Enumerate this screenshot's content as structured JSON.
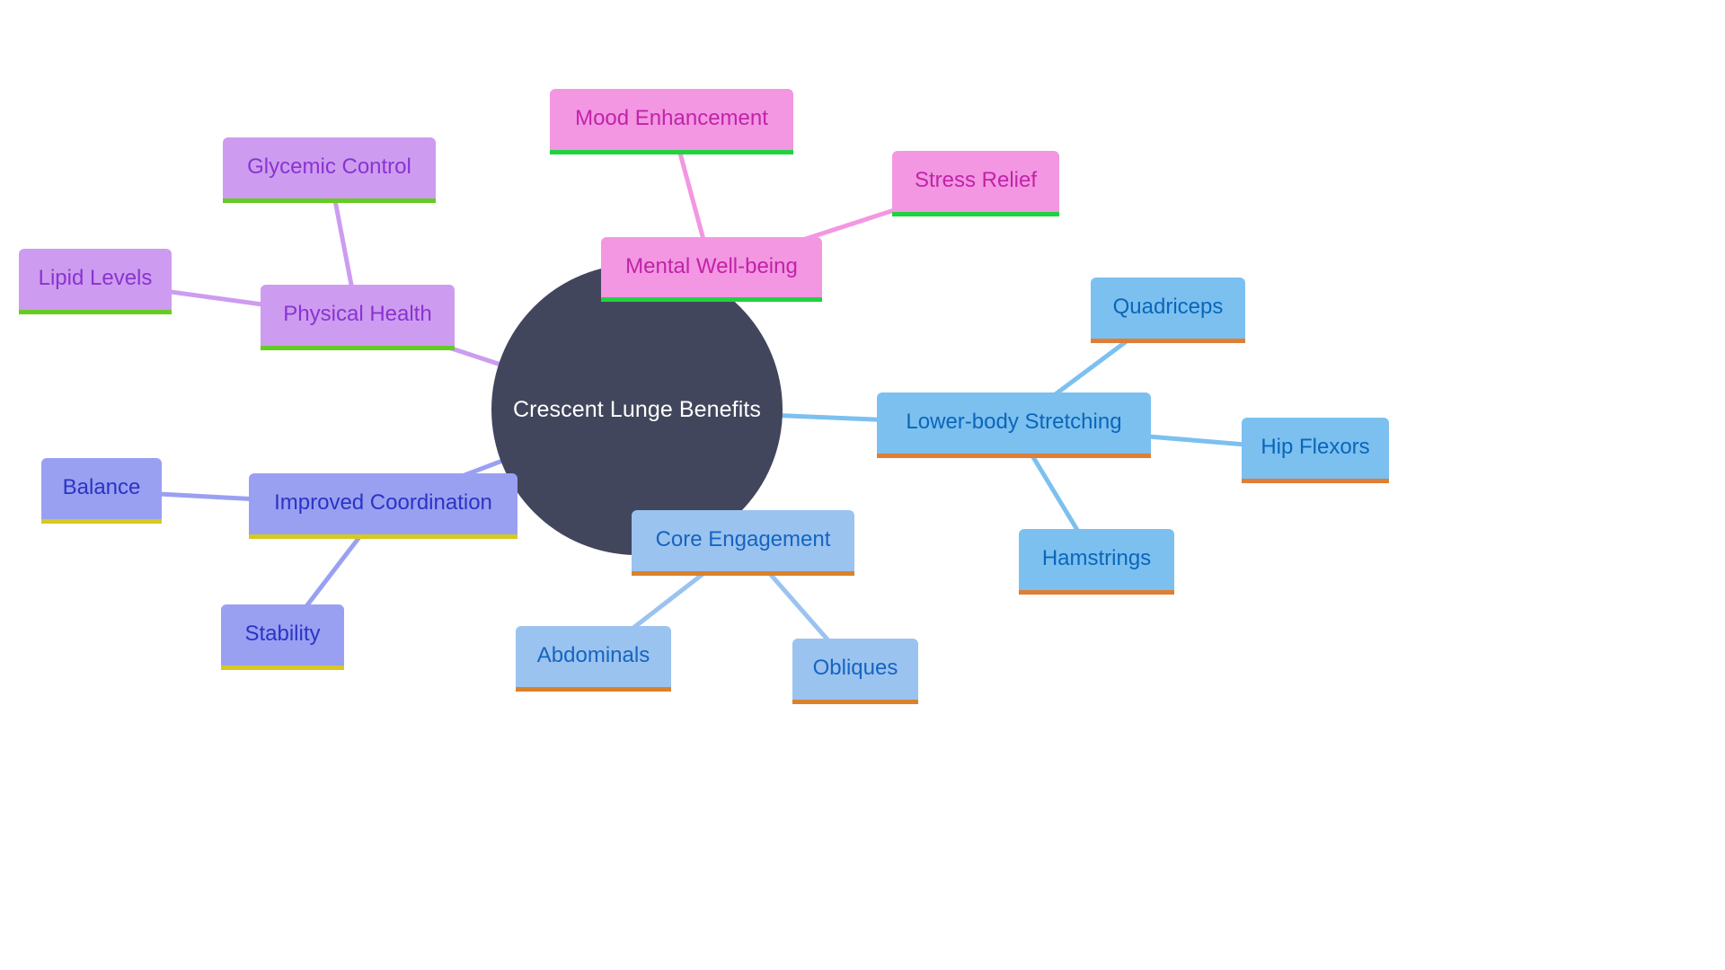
{
  "diagram": {
    "type": "mindmap",
    "root": {
      "label": "Crescent Lunge Benefits",
      "color": "#42465c"
    },
    "branches": [
      {
        "id": "mental",
        "label": "Mental Well-being",
        "theme": "pink",
        "edge_color": "#f397e2",
        "children": [
          {
            "id": "mood",
            "label": "Mood Enhancement"
          },
          {
            "id": "stress",
            "label": "Stress Relief"
          }
        ]
      },
      {
        "id": "physical",
        "label": "Physical Health",
        "theme": "purple",
        "edge_color": "#cd9cf0",
        "children": [
          {
            "id": "glycemic",
            "label": "Glycemic Control"
          },
          {
            "id": "lipid",
            "label": "Lipid Levels"
          }
        ]
      },
      {
        "id": "coordination",
        "label": "Improved Coordination",
        "theme": "indigo",
        "edge_color": "#9aa0f1",
        "children": [
          {
            "id": "balance",
            "label": "Balance"
          },
          {
            "id": "stability",
            "label": "Stability"
          }
        ]
      },
      {
        "id": "core",
        "label": "Core Engagement",
        "theme": "lblue",
        "edge_color": "#9bc3ef",
        "children": [
          {
            "id": "abdominals",
            "label": "Abdominals"
          },
          {
            "id": "obliques",
            "label": "Obliques"
          }
        ]
      },
      {
        "id": "lower",
        "label": "Lower-body Stretching",
        "theme": "blue",
        "edge_color": "#7cc0f0",
        "children": [
          {
            "id": "quadriceps",
            "label": "Quadriceps"
          },
          {
            "id": "hipflexors",
            "label": "Hip Flexors"
          },
          {
            "id": "hamstrings",
            "label": "Hamstrings"
          }
        ]
      }
    ]
  }
}
